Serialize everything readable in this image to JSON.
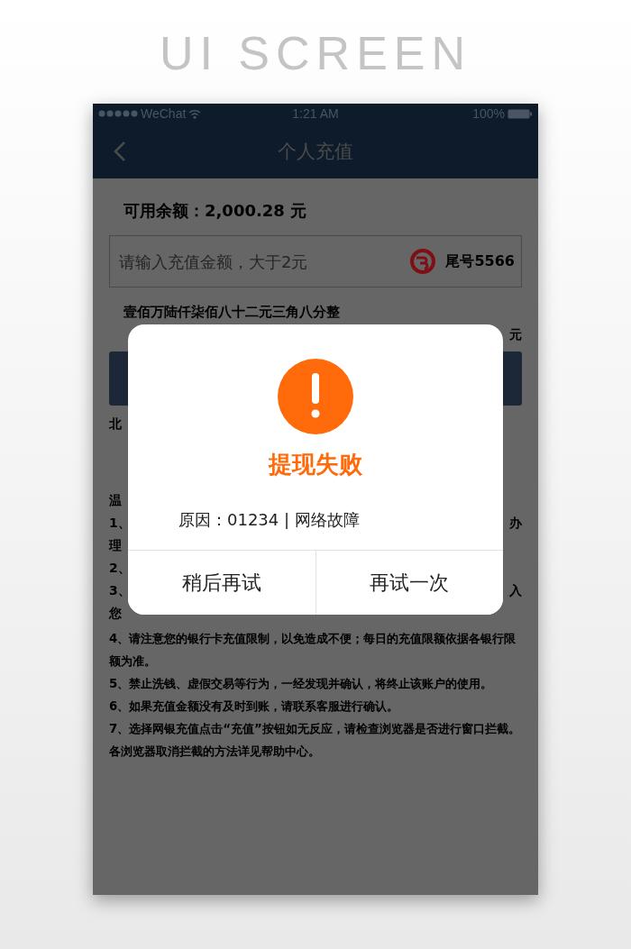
{
  "poster_title": "UI SCREEN",
  "status_bar": {
    "carrier": "WeChat",
    "time": "1:21 AM",
    "battery": "100%"
  },
  "nav": {
    "title": "个人充值"
  },
  "balance": "可用余额：2,000.28 元",
  "amount_input": {
    "placeholder": "请输入充值金额，大于2元",
    "card_tail": "尾号5566"
  },
  "amount_words": "壹佰万陆仟柒佰八十二元三角八分整",
  "partial_rows": [
    {
      "right": "元"
    },
    {
      "kind": "button"
    },
    {
      "left": "北"
    },
    {
      "kind": "gap"
    },
    {
      "left": "温"
    },
    {
      "left": "1、",
      "right": "办"
    },
    {
      "left": "理"
    },
    {
      "left": "2、"
    },
    {
      "left": "3、",
      "right": "入"
    },
    {
      "left": "您"
    }
  ],
  "notes": [
    "4、请注意您的银行卡充值限制，以免造成不便；每日的充值限额依据各银行限额为准。",
    "5、禁止洗钱、虚假交易等行为，一经发现并确认，将终止该账户的使用。",
    "6、如果充值金额没有及时到账，请联系客服进行确认。",
    "7、选择网银充值点击“充值”按钮如无反应，请检查浏览器是否进行窗口拦截。各浏览器取消拦截的方法详见帮助中心。"
  ],
  "dialog": {
    "title": "提现失败",
    "reason": "原因：01234 | 网络故障",
    "buttons": [
      "稍后再试",
      "再试一次"
    ]
  }
}
